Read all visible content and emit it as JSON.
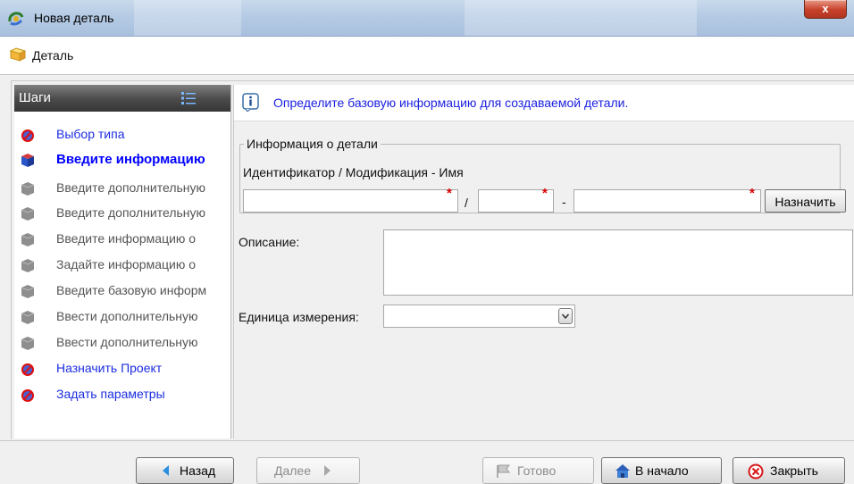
{
  "window": {
    "title": "Новая деталь",
    "close_label": "x"
  },
  "subheader": {
    "label": "Деталь"
  },
  "steps": {
    "header": "Шаги",
    "items": [
      {
        "label": "Выбор типа",
        "state": "active"
      },
      {
        "label": "Введите информацию",
        "state": "current"
      },
      {
        "label": "Введите дополнительную",
        "state": "disabled"
      },
      {
        "label": "Введите дополнительную",
        "state": "disabled"
      },
      {
        "label": "Введите информацию о",
        "state": "disabled"
      },
      {
        "label": "Задайте информацию о",
        "state": "disabled"
      },
      {
        "label": "Введите базовую информ",
        "state": "disabled"
      },
      {
        "label": "Ввести дополнительную",
        "state": "disabled"
      },
      {
        "label": "Ввести дополнительную",
        "state": "disabled"
      },
      {
        "label": "Назначить Проект",
        "state": "active"
      },
      {
        "label": "Задать параметры",
        "state": "active"
      }
    ]
  },
  "main": {
    "info_text": "Определите базовую информацию для создаваемой детали.",
    "group_legend": "Информация о детали",
    "ident_label": "Идентификатор / Модификация - Имя",
    "separator_slash": "/",
    "separator_dash": "-",
    "required_mark": "*",
    "id_value": "",
    "mod_value": "",
    "name_value": "",
    "assign_button": "Назначить",
    "description_label": "Описание:",
    "description_value": "",
    "unit_label": "Единица измерения:",
    "unit_value": ""
  },
  "footer": {
    "back": "Назад",
    "next": "Далее",
    "done": "Готово",
    "home": "В начало",
    "close": "Закрыть"
  },
  "icons": {
    "step_active": "blocked-part-icon",
    "step_current": "part-cube-icon",
    "step_disabled": "gray-part-icon"
  },
  "colors": {
    "link_blue": "#1c2de0",
    "current_blue": "#0000ff",
    "required_red": "#e00000",
    "close_red": "#c7412a"
  }
}
